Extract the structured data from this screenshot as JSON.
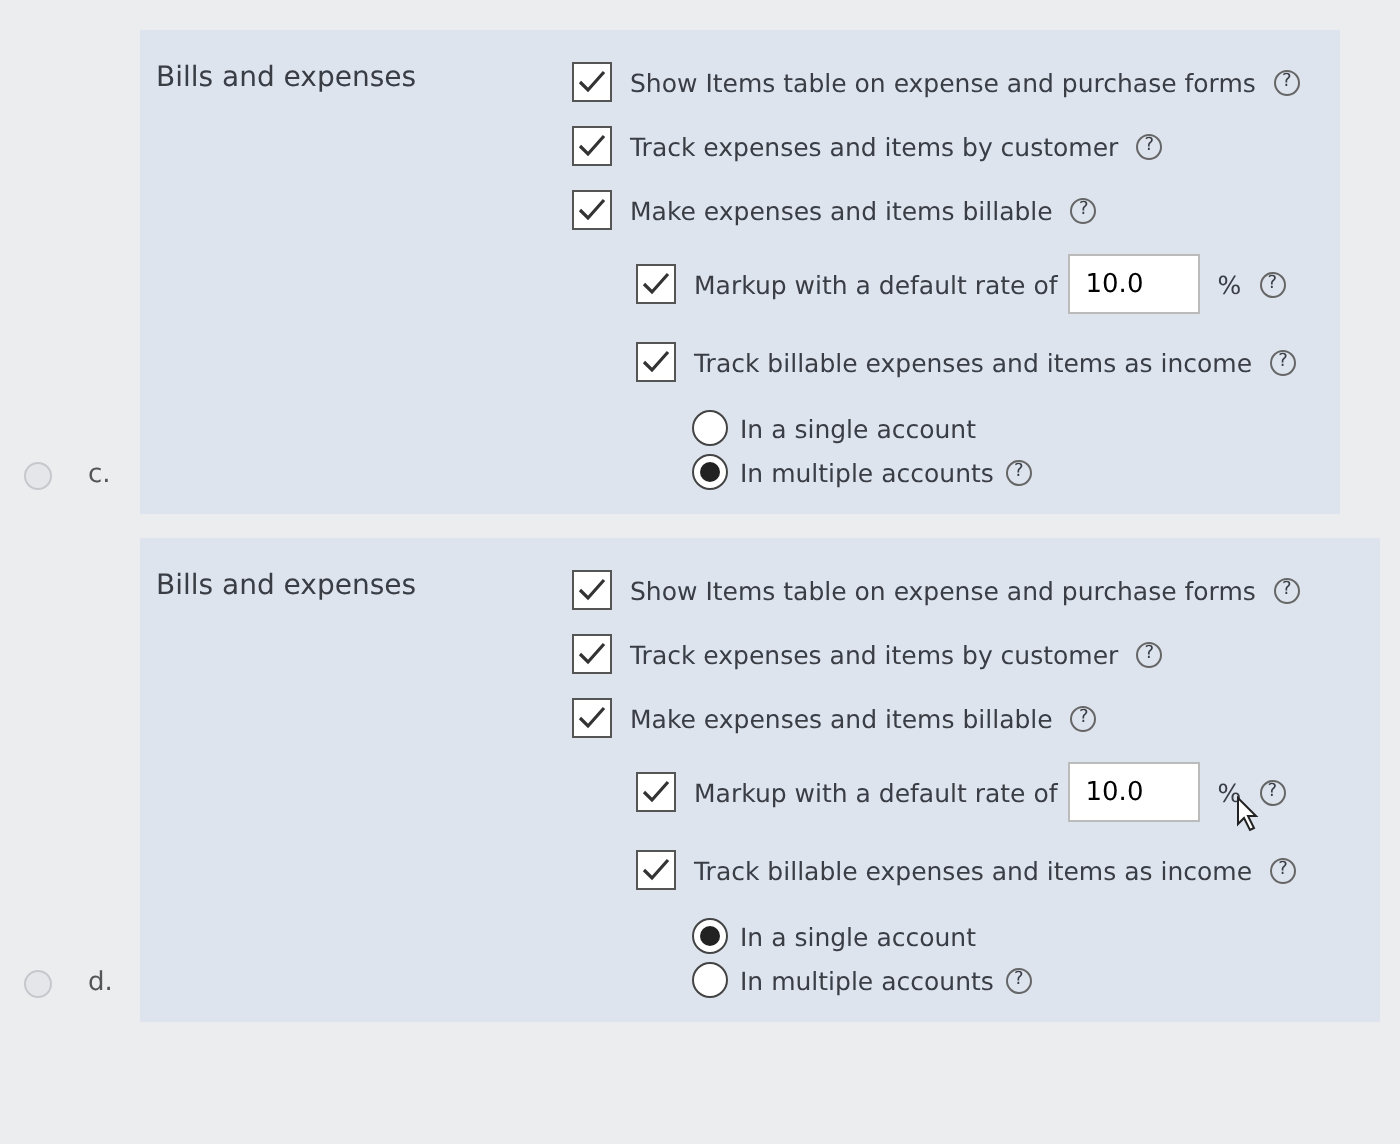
{
  "options": [
    {
      "letter": "c.",
      "selected": false,
      "section": "Bills and expenses",
      "items": [
        {
          "kind": "check",
          "label": "Show Items table on expense and purchase forms",
          "checked": true,
          "help": "?"
        },
        {
          "kind": "check",
          "label": "Track expenses and items by customer",
          "checked": true,
          "help": "?"
        },
        {
          "kind": "check",
          "label": "Make expenses and items billable",
          "checked": true,
          "help": "?",
          "children": [
            {
              "kind": "rate",
              "label": "Markup with a default rate of",
              "checked": true,
              "value": "10.0",
              "unit": "%",
              "cursor": false,
              "help": "?"
            },
            {
              "kind": "check",
              "label": "Track billable expenses and items as income",
              "checked": true,
              "help": "?",
              "radios": [
                {
                  "label": "In a single account",
                  "selected": false
                },
                {
                  "label": "In multiple accounts",
                  "selected": true,
                  "help": "?"
                }
              ]
            }
          ]
        }
      ]
    },
    {
      "letter": "d.",
      "selected": false,
      "section": "Bills and expenses",
      "items": [
        {
          "kind": "check",
          "label": "Show Items table on expense and purchase forms",
          "checked": true,
          "help": "?"
        },
        {
          "kind": "check",
          "label": "Track expenses and items by customer",
          "checked": true,
          "help": "?"
        },
        {
          "kind": "check",
          "label": "Make expenses and items billable",
          "checked": true,
          "help": "?",
          "children": [
            {
              "kind": "rate",
              "label": "Markup with a default rate of",
              "checked": true,
              "value": "10.0",
              "unit": "%",
              "cursor": true,
              "help": "?"
            },
            {
              "kind": "check",
              "label": "Track billable expenses and items as income",
              "checked": true,
              "help": "?",
              "radios": [
                {
                  "label": "In a single account",
                  "selected": true
                },
                {
                  "label": "In multiple accounts",
                  "selected": false,
                  "help": "?"
                }
              ]
            }
          ]
        }
      ]
    }
  ]
}
